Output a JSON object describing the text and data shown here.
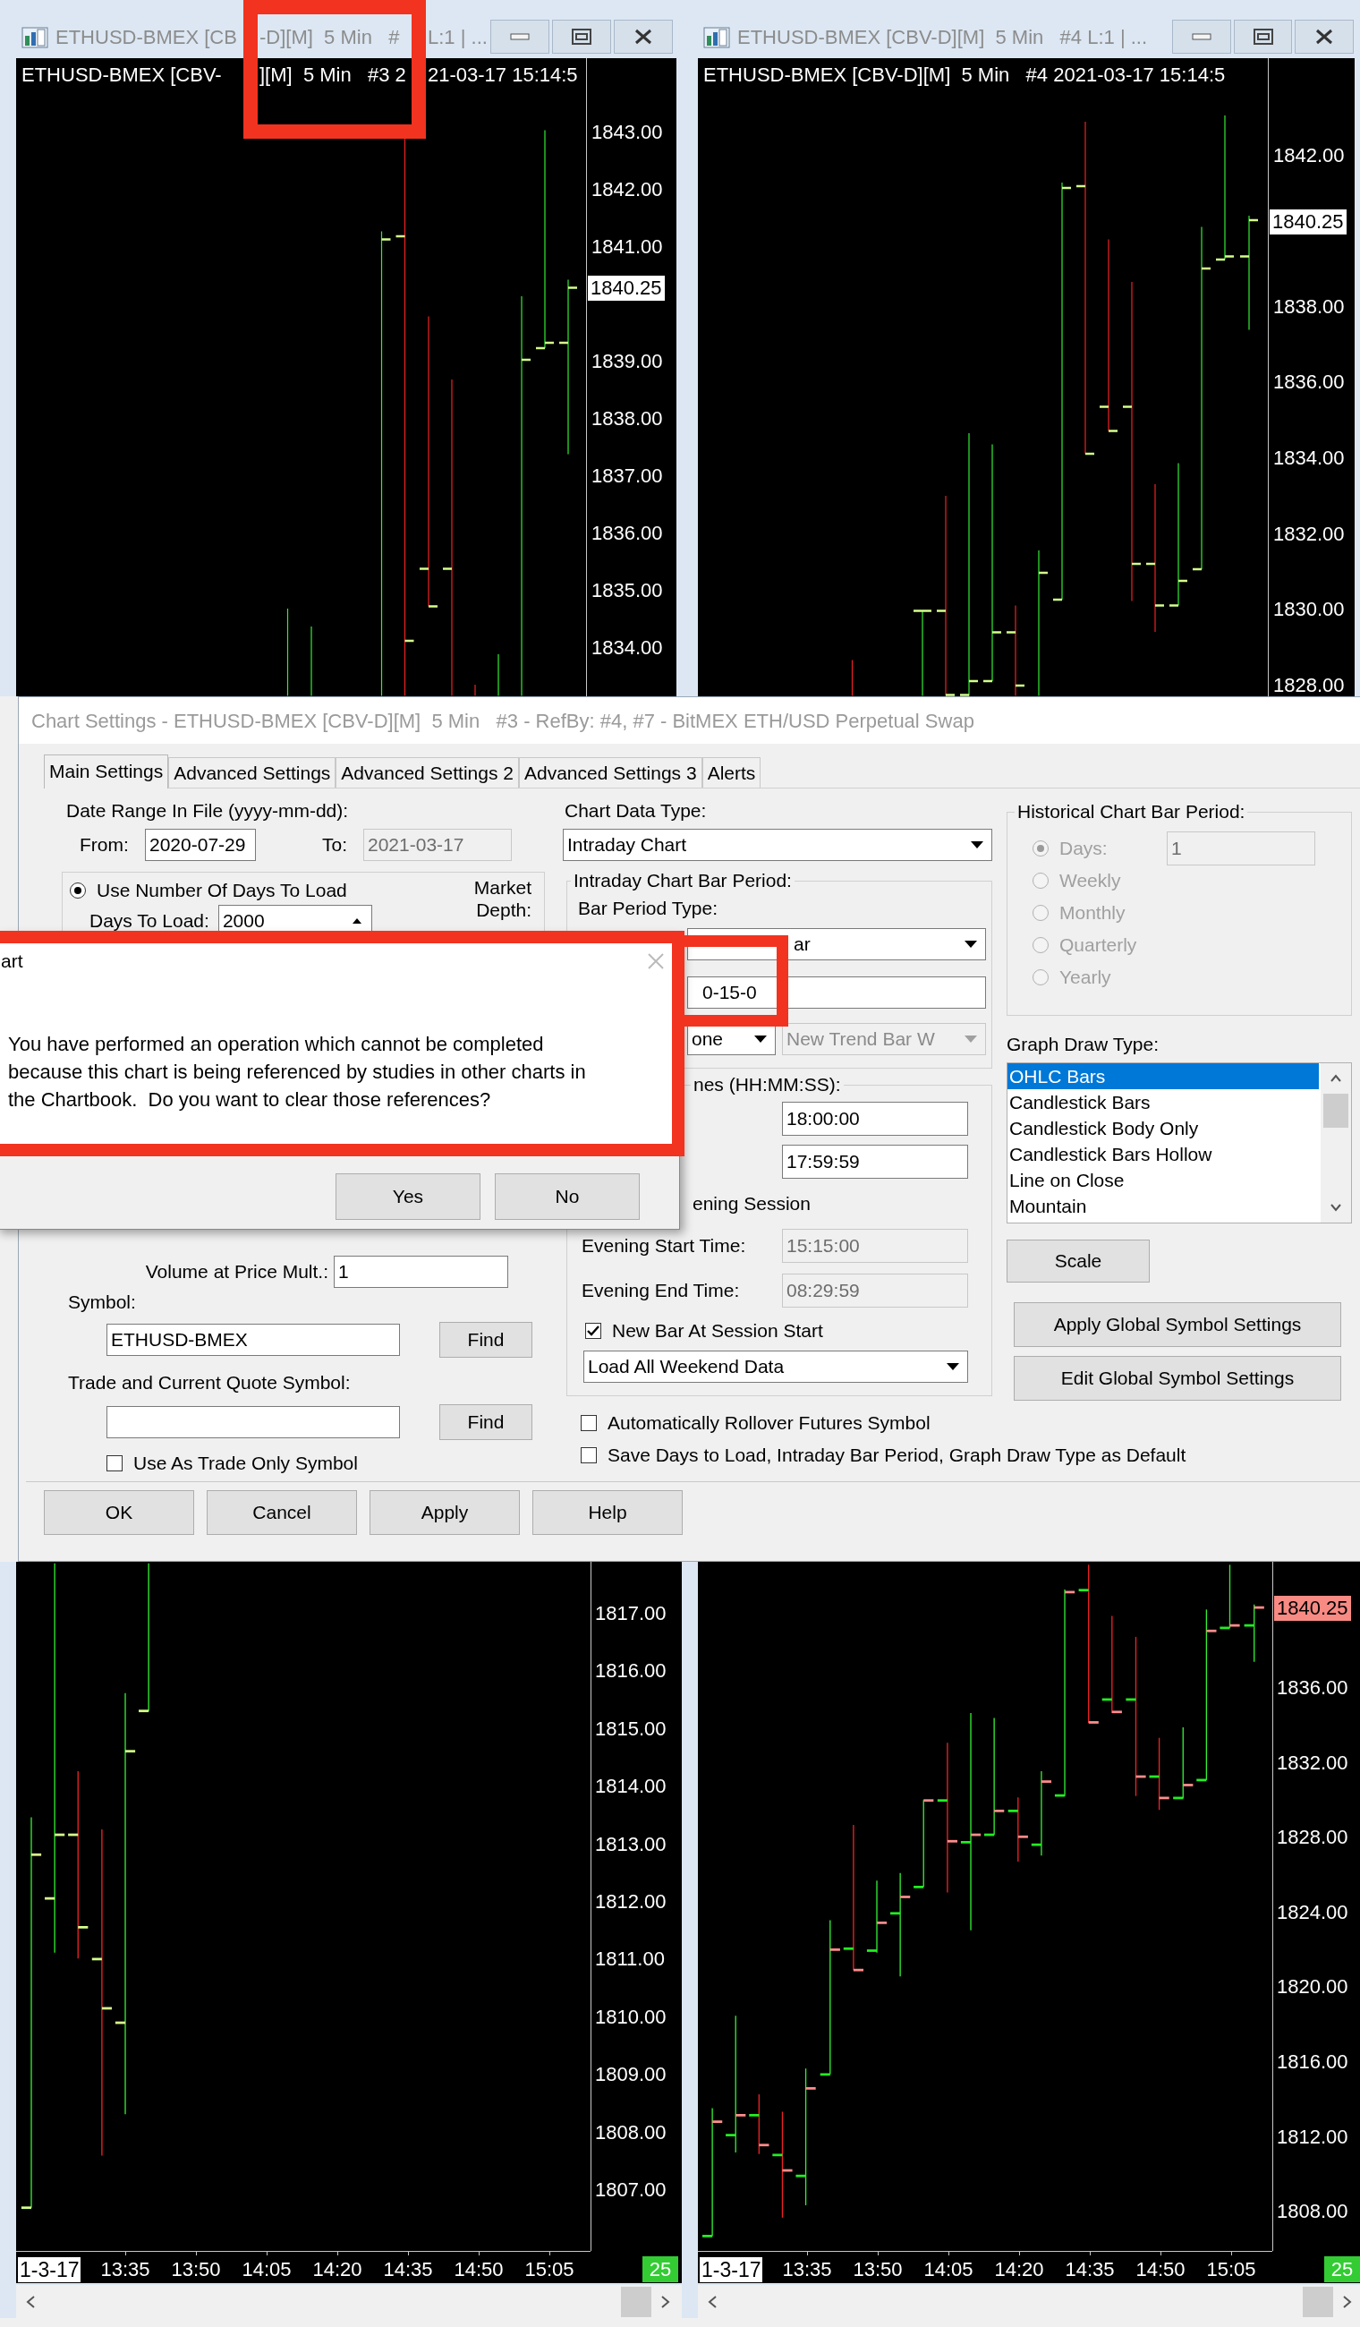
{
  "chart_windows": [
    {
      "kind": "top",
      "title": [
        "ETHUSD-BMEX [CB",
        "-D][M]  5 Min   #",
        "L:1 | ..."
      ],
      "header": [
        "ETHUSD-BMEX [CBV-",
        "][M]  5 Min   #3 2",
        "21-03-17 15:14:5"
      ],
      "price_labels": [
        "1843.00",
        "1842.00",
        "1841.00",
        "1839.00",
        "1838.00",
        "1837.00",
        "1836.00",
        "1835.00",
        "1834.00"
      ],
      "last_price": {
        "text": "1840.25",
        "color": "#ffffff"
      }
    },
    {
      "kind": "top",
      "title": [
        "ETHUSD-BMEX [CBV-D][M]  5 Min   #4 L:1 | ..."
      ],
      "header": [
        "ETHUSD-BMEX [CBV-D][M]  5 Min   #4 2021-03-17 15:14:5"
      ],
      "price_labels": [
        "1842.00",
        "1838.00",
        "1836.00",
        "1834.00",
        "1832.00",
        "1830.00",
        "1828.00"
      ],
      "last_price": {
        "text": "1840.25",
        "color": "#ffffff"
      }
    },
    {
      "kind": "bottom",
      "price_labels": [
        "1817.00",
        "1816.00",
        "1815.00",
        "1814.00",
        "1813.00",
        "1812.00",
        "1811.00",
        "1810.00",
        "1809.00",
        "1808.00",
        "1807.00"
      ],
      "date_label": "1-3-17",
      "time_labels": [
        "13:35",
        "13:50",
        "14:05",
        "14:20",
        "14:35",
        "14:50",
        "15:05"
      ],
      "bar_count": "25"
    },
    {
      "kind": "bottom",
      "price_labels": [
        "1836.00",
        "1832.00",
        "1828.00",
        "1824.00",
        "1820.00",
        "1816.00",
        "1812.00",
        "1808.00"
      ],
      "last_price": {
        "text": "1840.25",
        "color": "#f88a84"
      },
      "date_label": "1-3-17",
      "time_labels": [
        "13:35",
        "13:50",
        "14:05",
        "14:20",
        "14:35",
        "14:50",
        "15:05"
      ],
      "bar_count": "25"
    }
  ],
  "dialog": {
    "title": "Chart Settings - ETHUSD-BMEX [CBV-D][M]  5 Min   #3 - RefBy: #4, #7 - BitMEX ETH/USD Perpetual Swap",
    "tabs": [
      {
        "label": "Main Settings",
        "selected": true
      },
      {
        "label": "Advanced Settings",
        "selected": false
      },
      {
        "label": "Advanced Settings 2",
        "selected": false
      },
      {
        "label": "Advanced Settings 3",
        "selected": false
      },
      {
        "label": "Alerts",
        "selected": false
      }
    ],
    "date_range_label": "Date Range In File (yyyy-mm-dd):",
    "from": {
      "label": "From:",
      "value": "2020-07-29"
    },
    "to": {
      "label": "To:",
      "value": "2021-03-17",
      "disabled": true
    },
    "use_days": {
      "label": "Use Number Of Days To Load",
      "selected": true
    },
    "days_to_load": {
      "label": "Days To Load:",
      "value": "2000"
    },
    "market_depth_label": "Market Depth:",
    "volume_mult": {
      "label": "Volume at Price Mult.:",
      "value": "1"
    },
    "symbol": {
      "label": "Symbol:",
      "value": "ETHUSD-BMEX",
      "button": "Find"
    },
    "trade_symbol": {
      "label": "Trade and Current Quote Symbol:",
      "button": "Find"
    },
    "trade_only": {
      "label": "Use As Trade Only Symbol",
      "checked": false
    },
    "chart_data_type": {
      "label": "Chart Data Type:",
      "value": "Intraday Chart"
    },
    "intraday_group": {
      "label": "Intraday Chart Bar Period:",
      "type_label": "Bar Period Type:",
      "type_value": "ar",
      "period_value": "0-15-0",
      "select_3": {
        "value": "one",
        "disabled": false
      },
      "select_4": {
        "value": "New Trend Bar W",
        "disabled": true
      }
    },
    "session_group": {
      "label": "nes (HH:MM:SS):",
      "start": "18:00:00",
      "end": "17:59:59",
      "evening_label": "ening Session",
      "evening_start": {
        "label": "Evening Start Time:",
        "value": "15:15:00",
        "disabled": true
      },
      "evening_end": {
        "label": "Evening End Time:",
        "value": "08:29:59",
        "disabled": true
      },
      "new_bar": {
        "label": "New Bar At Session Start",
        "checked": true
      },
      "weekend": "Load All Weekend Data"
    },
    "rollover": {
      "label": "Automatically Rollover Futures Symbol",
      "checked": false
    },
    "save_default": {
      "label": "Save Days to Load, Intraday Bar Period, Graph Draw Type as Default",
      "checked": false
    },
    "historical_group": {
      "label": "Historical Chart Bar Period:",
      "days_value": "1",
      "options": [
        {
          "label": "Days:",
          "selected": true,
          "disabled": true
        },
        {
          "label": "Weekly",
          "selected": false,
          "disabled": true
        },
        {
          "label": "Monthly",
          "selected": false,
          "disabled": true
        },
        {
          "label": "Quarterly",
          "selected": false,
          "disabled": true
        },
        {
          "label": "Yearly",
          "selected": false,
          "disabled": true
        }
      ]
    },
    "graph_draw_type": {
      "label": "Graph Draw Type:",
      "items": [
        {
          "label": "OHLC Bars",
          "selected": true
        },
        {
          "label": "Candlestick Bars",
          "selected": false
        },
        {
          "label": "Candlestick Body Only",
          "selected": false
        },
        {
          "label": "Candlestick Bars Hollow",
          "selected": false
        },
        {
          "label": "Line on Close",
          "selected": false
        },
        {
          "label": "Mountain",
          "selected": false
        }
      ]
    },
    "side_buttons": [
      "Scale",
      "Apply Global Symbol Settings",
      "Edit Global Symbol Settings"
    ],
    "buttons": [
      "OK",
      "Cancel",
      "Apply",
      "Help"
    ]
  },
  "message_box": {
    "title": "art",
    "text": "You have performed an operation which cannot be completed because this chart is being referenced by studies in other charts in the Chartbook.  Do you want to clear those references?",
    "buttons": [
      "Yes",
      "No"
    ]
  },
  "annotations": [
    {
      "kind": "highlight"
    },
    {
      "kind": "highlight"
    },
    {
      "kind": "highlight"
    }
  ]
}
